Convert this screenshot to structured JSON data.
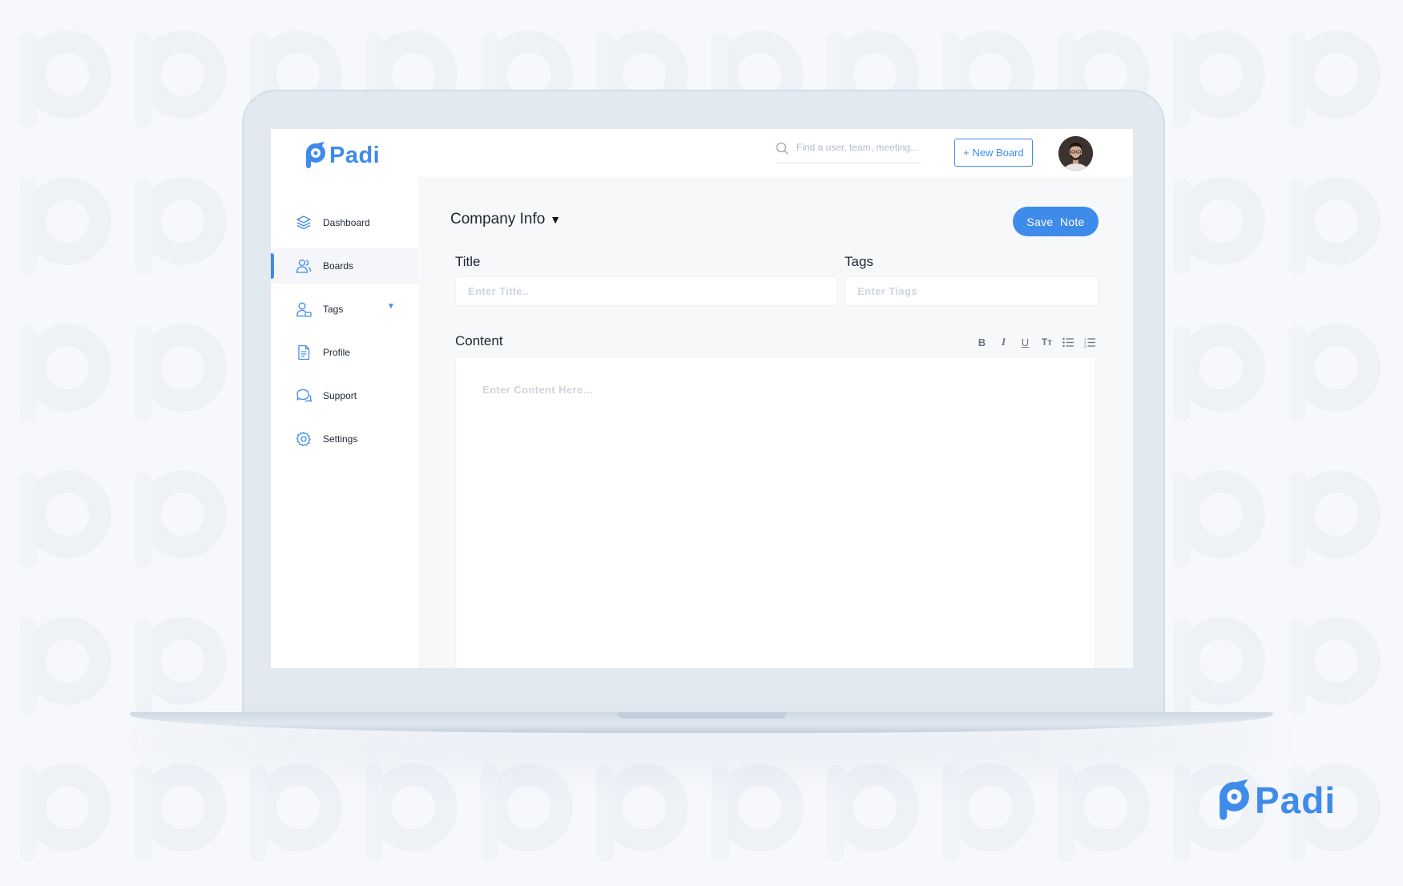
{
  "app": {
    "name": "Padi"
  },
  "colors": {
    "accent": "#3f8bea",
    "sidebar_active_bg": "#f4f6f9",
    "main_bg": "#f6f8fa",
    "page_bg": "#f6f8fb"
  },
  "header": {
    "search": {
      "placeholder": "Find a user, team, meeting..."
    },
    "new_board_label": "+ New Board"
  },
  "sidebar": {
    "items": [
      {
        "label": "Dashboard",
        "icon": "layers-icon",
        "active": false
      },
      {
        "label": "Boards",
        "icon": "users-icon",
        "active": true
      },
      {
        "label": "Tags",
        "icon": "user-tag-icon",
        "active": false,
        "has_dropdown": true
      },
      {
        "label": "Profile",
        "icon": "document-icon",
        "active": false
      },
      {
        "label": "Support",
        "icon": "chat-icon",
        "active": false
      },
      {
        "label": "Settings",
        "icon": "gear-icon",
        "active": false
      }
    ]
  },
  "main": {
    "board_name": "Company Info",
    "save_label": "Save  Note",
    "title_field": {
      "label": "Title",
      "placeholder": "Enter Title.."
    },
    "tags_field": {
      "label": "Tags",
      "placeholder": "Enter Tiags"
    },
    "content": {
      "label": "Content",
      "placeholder": "Enter Content Here...",
      "toolbar": [
        {
          "icon": "bold-icon",
          "glyph": "B"
        },
        {
          "icon": "italic-icon",
          "glyph": "I"
        },
        {
          "icon": "underline-icon",
          "glyph": "U"
        },
        {
          "icon": "text-size-icon",
          "glyph": "Tт"
        },
        {
          "icon": "bullet-list-icon",
          "glyph": ""
        },
        {
          "icon": "numbered-list-icon",
          "glyph": ""
        }
      ]
    }
  }
}
